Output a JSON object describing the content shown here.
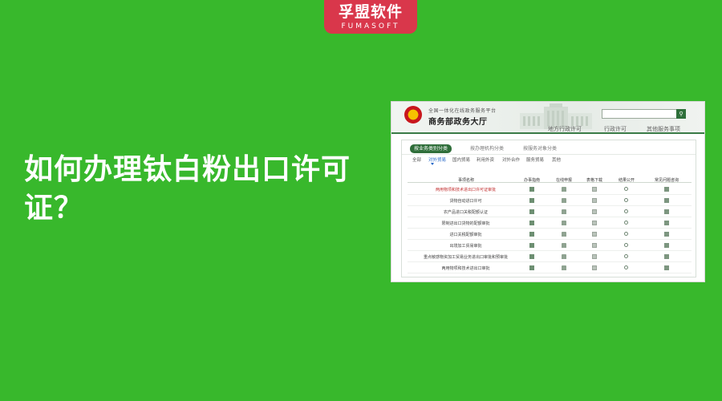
{
  "brand": {
    "name": "孚盟软件",
    "subtitle": "FUMASOFT",
    "color": "#d9374b"
  },
  "headline": "如何办理钛白粉出口许可证？",
  "background_color": "#38b82c",
  "site": {
    "subtitle": "全国一体化在线政务服务平台",
    "title": "商务部政务大厅",
    "search_icon": "search-icon",
    "nav": [
      "地方行政许可",
      "行政许可",
      "其他服务事项"
    ]
  },
  "category_tabs": [
    "按业务类别分类",
    "按办理机构分类",
    "按服务对象分类"
  ],
  "sub_tabs": [
    "全部",
    "对外贸易",
    "国内贸易",
    "利用外资",
    "对外合作",
    "服务贸易",
    "其他"
  ],
  "table": {
    "headers": [
      "事项名称",
      "办事指南",
      "在线申报",
      "表格下载",
      "结果公开",
      "常见问题咨询"
    ],
    "rows": [
      {
        "name": "两用物项和技术进出口许可证审批",
        "highlight": true
      },
      {
        "name": "货物自动进口许可",
        "highlight": false
      },
      {
        "name": "农产品进口关税配额认证",
        "highlight": false
      },
      {
        "name": "限制进出口货物的配额审批",
        "highlight": false
      },
      {
        "name": "进口关税配额审批",
        "highlight": false
      },
      {
        "name": "出境加工贸易审批",
        "highlight": false
      },
      {
        "name": "重点敏感物资加工贸易业务进出口审批和预审批",
        "highlight": false
      },
      {
        "name": "两用物项和技术进出口审批",
        "highlight": false
      }
    ]
  }
}
